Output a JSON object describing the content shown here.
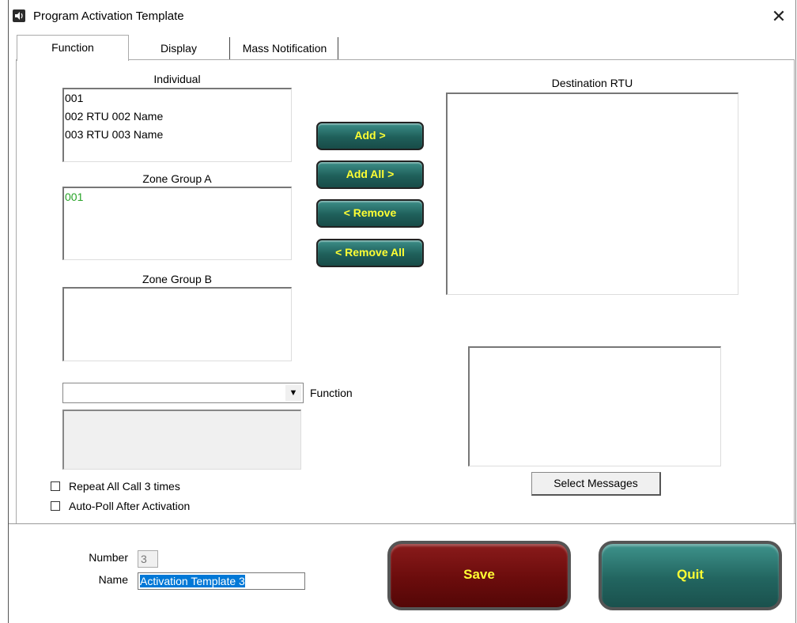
{
  "window": {
    "title": "Program Activation Template",
    "close_label": "✕"
  },
  "tabs": [
    {
      "label": "Function",
      "active": true
    },
    {
      "label": "Display",
      "active": false
    },
    {
      "label": "Mass Notification",
      "active": false
    }
  ],
  "individual": {
    "label": "Individual",
    "items": [
      "001",
      "002 RTU 002 Name",
      "003 RTU 003 Name"
    ]
  },
  "zone_group_a": {
    "label": "Zone Group A",
    "items": [
      "001"
    ]
  },
  "zone_group_b": {
    "label": "Zone Group B",
    "items": []
  },
  "transfer_buttons": {
    "add": "Add >",
    "add_all": "Add All >",
    "remove": "< Remove",
    "remove_all": "< Remove All"
  },
  "destination": {
    "label": "Destination RTU",
    "items": []
  },
  "function_select": {
    "label": "Function",
    "value": ""
  },
  "options": {
    "repeat_all_call": {
      "label": "Repeat All Call 3 times",
      "checked": false
    },
    "auto_poll": {
      "label": "Auto-Poll After Activation",
      "checked": false
    }
  },
  "messages": {
    "select_button": "Select Messages"
  },
  "template": {
    "number_label": "Number",
    "number_value": "3",
    "name_label": "Name",
    "name_value": "Activation Template 3"
  },
  "actions": {
    "save": "Save",
    "quit": "Quit"
  },
  "colors": {
    "accent_text": "#ffff33",
    "teal_button": "#1f5f5a",
    "save_button": "#6b0c0c",
    "zone_item": "#27a327"
  }
}
